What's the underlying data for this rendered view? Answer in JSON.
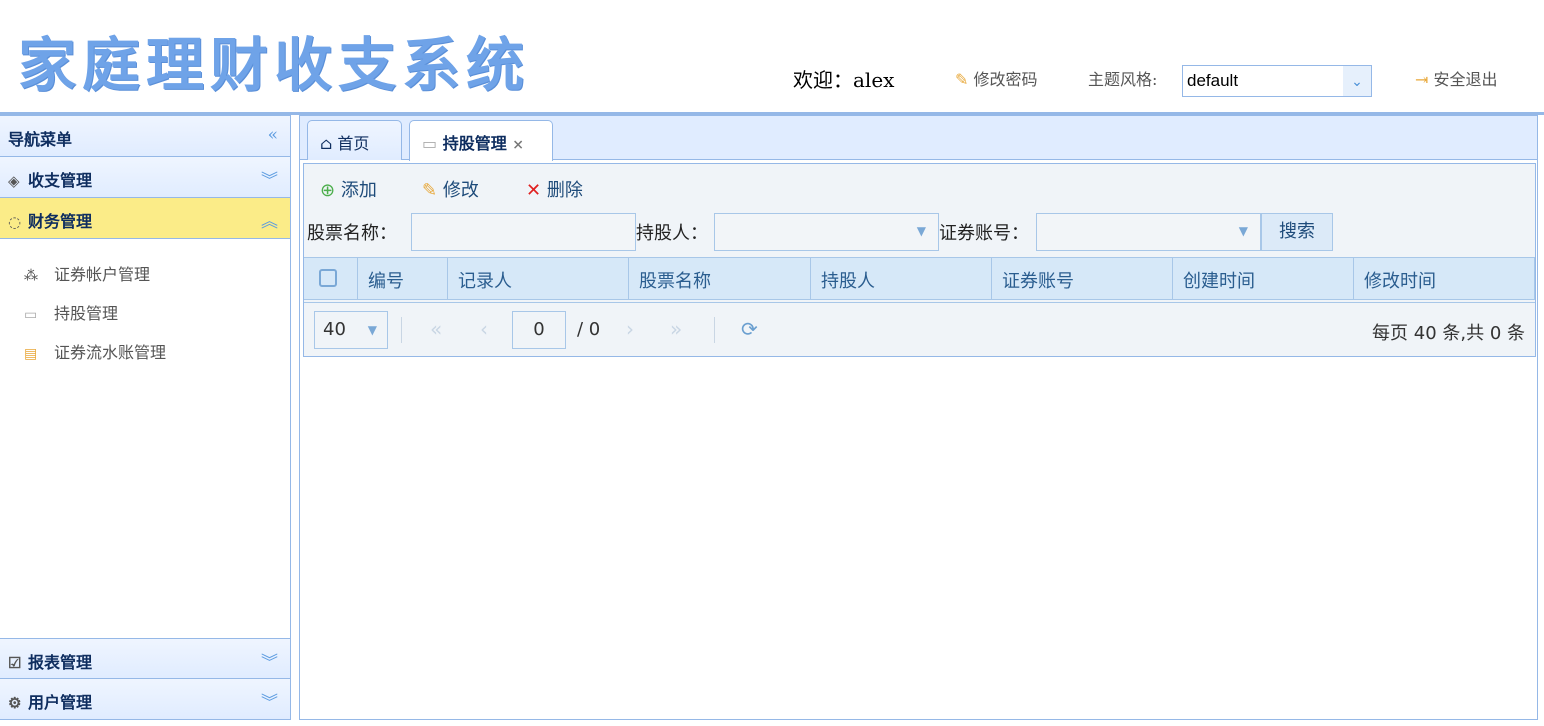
{
  "header": {
    "logo": "家庭理财收支系统",
    "welcome": "欢迎：alex",
    "change_password": "修改密码",
    "theme_label": "主题风格:",
    "theme_value": "default",
    "logout": "安全退出"
  },
  "sidebar": {
    "title": "导航菜单",
    "groups": [
      {
        "label": "收支管理"
      },
      {
        "label": "财务管理",
        "items": [
          "证券帐户管理",
          "持股管理",
          "证券流水账管理"
        ]
      },
      {
        "label": "报表管理"
      },
      {
        "label": "用户管理"
      }
    ]
  },
  "tabs": [
    {
      "label": "首页"
    },
    {
      "label": "持股管理",
      "close": "×"
    }
  ],
  "toolbar": {
    "add": "添加",
    "edit": "修改",
    "delete": "删除"
  },
  "search": {
    "stock_name_label": "股票名称：",
    "holder_label": "持股人：",
    "account_label": "证券账号：",
    "button": "搜索"
  },
  "grid": {
    "columns": [
      "编号",
      "记录人",
      "股票名称",
      "持股人",
      "证券账号",
      "创建时间",
      "修改时间"
    ]
  },
  "pager": {
    "page_size": "40",
    "page": "0",
    "total_pages": "/ 0",
    "summary": "每页 40 条,共 0 条"
  }
}
